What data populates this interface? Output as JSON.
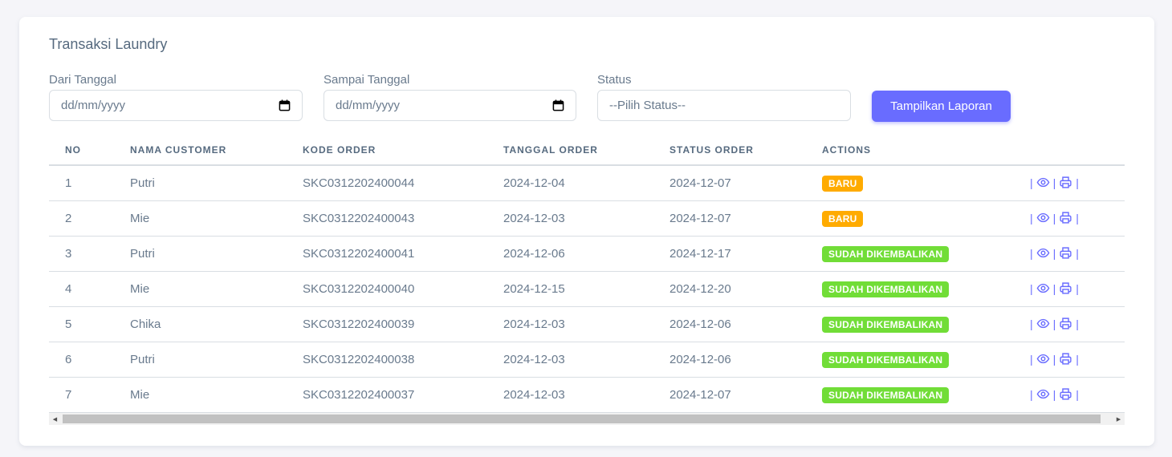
{
  "card": {
    "title": "Transaksi Laundry"
  },
  "filters": {
    "from_label": "Dari Tanggal",
    "from_value": "dd/mm/yyyy",
    "to_label": "Sampai Tanggal",
    "to_value": "dd/mm/yyyy",
    "status_label": "Status",
    "status_value": "--Pilih Status--",
    "submit_label": "Tampilkan Laporan"
  },
  "table": {
    "headers": [
      "NO",
      "NAMA CUSTOMER",
      "KODE ORDER",
      "TANGGAL ORDER",
      "STATUS ORDER",
      "ACTIONS"
    ],
    "rows": [
      {
        "no": "1",
        "name": "Putri",
        "code": "SKC0312202400044",
        "order_date": "2024-12-04",
        "status_date": "2024-12-07",
        "status": "BARU"
      },
      {
        "no": "2",
        "name": "Mie",
        "code": "SKC0312202400043",
        "order_date": "2024-12-03",
        "status_date": "2024-12-07",
        "status": "BARU"
      },
      {
        "no": "3",
        "name": "Putri",
        "code": "SKC0312202400041",
        "order_date": "2024-12-06",
        "status_date": "2024-12-17",
        "status": "SUDAH DIKEMBALIKAN"
      },
      {
        "no": "4",
        "name": "Mie",
        "code": "SKC0312202400040",
        "order_date": "2024-12-15",
        "status_date": "2024-12-20",
        "status": "SUDAH DIKEMBALIKAN"
      },
      {
        "no": "5",
        "name": "Chika",
        "code": "SKC0312202400039",
        "order_date": "2024-12-03",
        "status_date": "2024-12-06",
        "status": "SUDAH DIKEMBALIKAN"
      },
      {
        "no": "6",
        "name": "Putri",
        "code": "SKC0312202400038",
        "order_date": "2024-12-03",
        "status_date": "2024-12-06",
        "status": "SUDAH DIKEMBALIKAN"
      },
      {
        "no": "7",
        "name": "Mie",
        "code": "SKC0312202400037",
        "order_date": "2024-12-03",
        "status_date": "2024-12-07",
        "status": "SUDAH DIKEMBALIKAN"
      }
    ],
    "action_separator": "|"
  },
  "colors": {
    "primary": "#696cff",
    "badge_baru": "#ffab00",
    "badge_sudah": "#71dd37",
    "text": "#697a8d",
    "border": "#d9dee3"
  },
  "icons": {
    "calendar": "calendar-icon",
    "view": "eye-icon",
    "print": "printer-icon"
  }
}
